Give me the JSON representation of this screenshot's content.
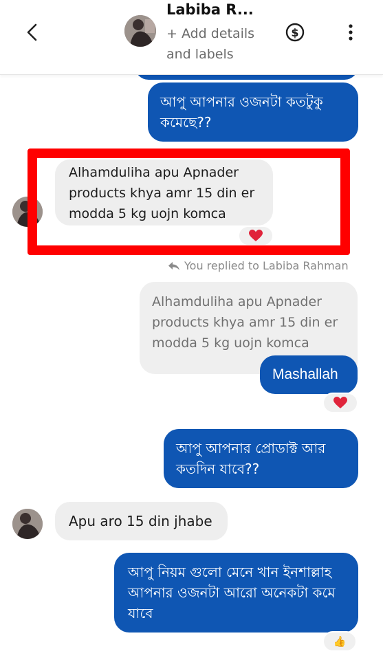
{
  "header": {
    "contact_name": "Labiba R...",
    "subtitle": "+ Add details and labels",
    "back_icon": "chevron-left-icon",
    "payment_icon": "dollar-circle-icon",
    "menu_icon": "more-vertical-icon"
  },
  "colors": {
    "outgoing_bubble": "#0f56b3",
    "incoming_bubble": "#eeeeee",
    "highlight_box": "#ff0000",
    "heart": "#e0243b"
  },
  "messages": [
    {
      "id": "m1",
      "direction": "out",
      "text": "আপু আপনার ওজনটা কতটুকু কমেছে??"
    },
    {
      "id": "m2",
      "direction": "in",
      "text": "Alhamduliha apu Apnader products khya amr 15 din er modda 5 kg uojn komca",
      "reaction": "❤️"
    },
    {
      "id": "m3",
      "direction": "out",
      "reply_label": "You replied to Labiba Rahman",
      "quoted_text": "Alhamduliha apu Apnader products khya amr 15 din er modda 5 kg uojn komca",
      "text": "Mashallah",
      "reaction": "❤️"
    },
    {
      "id": "m4",
      "direction": "out",
      "text": "আপু আপনার প্রোডাক্ট আর কতদিন যাবে??"
    },
    {
      "id": "m5",
      "direction": "in",
      "text": "Apu aro 15 din  jhabe"
    },
    {
      "id": "m6",
      "direction": "out",
      "text": "আপু নিয়ম গুলো মেনে খান ইনশাল্লাহ আপনার ওজনটা আরো অনেকটা  কমে যাবে",
      "reaction": "👍"
    }
  ]
}
